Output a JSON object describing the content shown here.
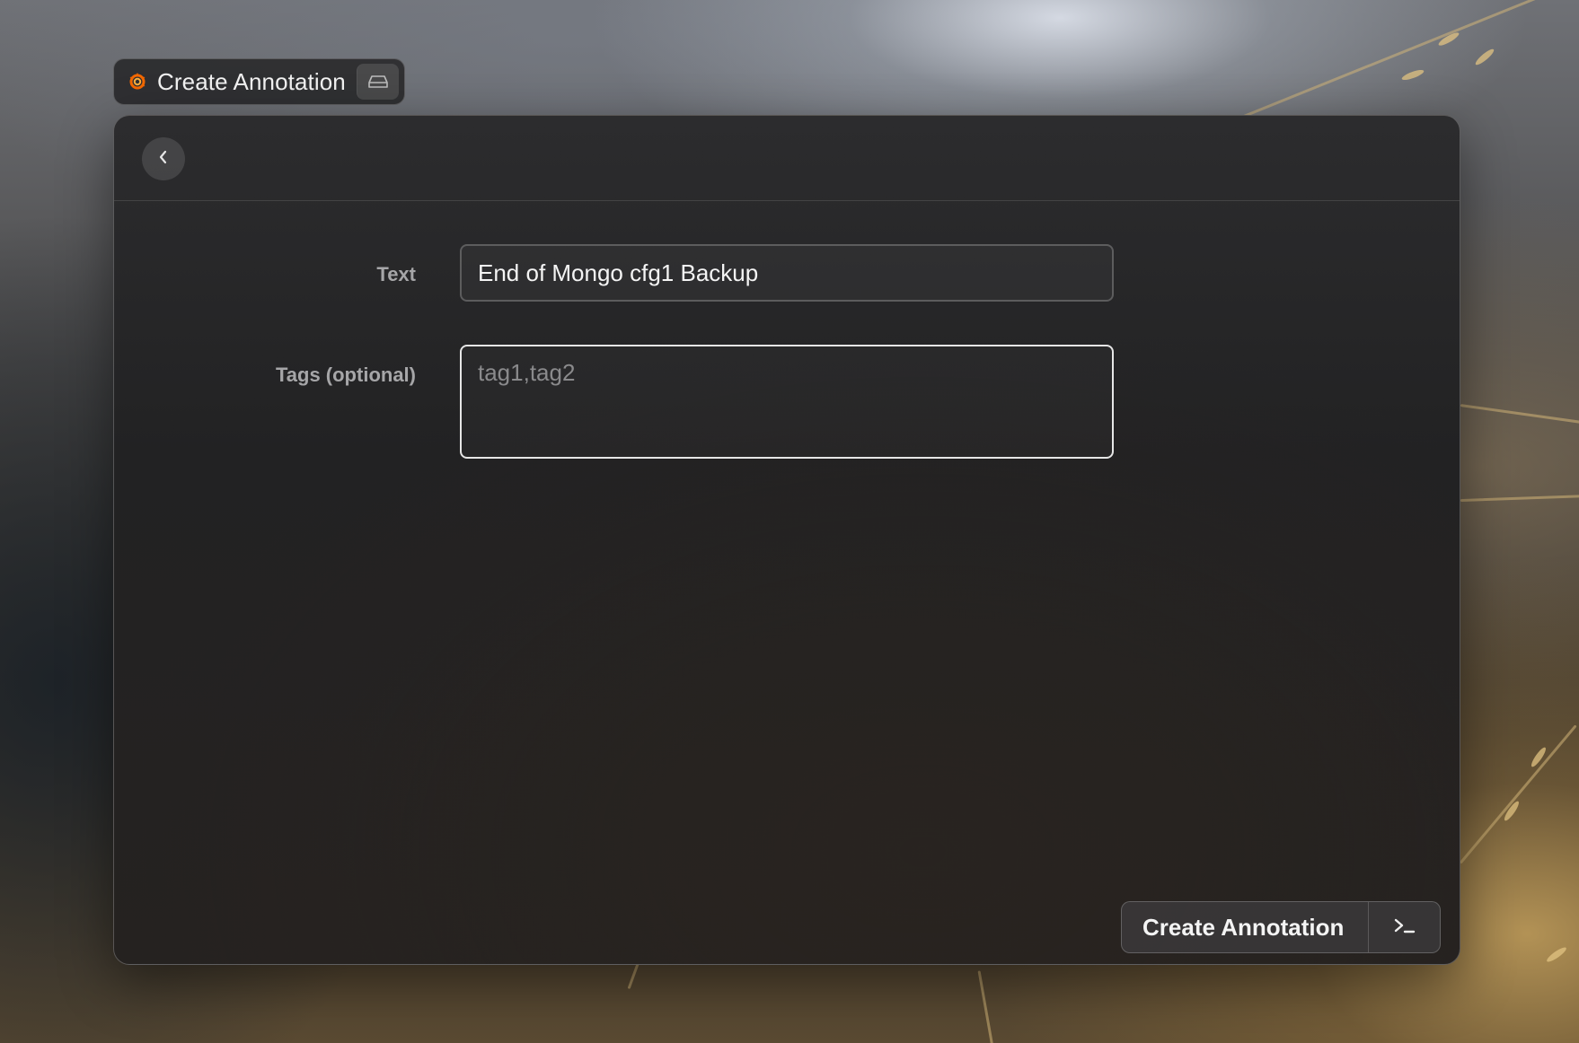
{
  "title_bar": {
    "title": "Create Annotation",
    "app_icon": "grafana-icon",
    "toggle_icon": "drive-icon"
  },
  "header": {
    "back_icon": "chevron-left-icon"
  },
  "form": {
    "text_label": "Text",
    "text_value": "End of Mongo cfg1 Backup",
    "tags_label": "Tags (optional)",
    "tags_value": "",
    "tags_placeholder": "tag1,tag2"
  },
  "footer": {
    "primary_action_label": "Create Annotation",
    "shortcut_icon": "terminal-icon"
  },
  "colors": {
    "accent": "#f46800",
    "window_bg": "#242425",
    "text": "#f4f4f4",
    "label": "#a6a6a8"
  }
}
